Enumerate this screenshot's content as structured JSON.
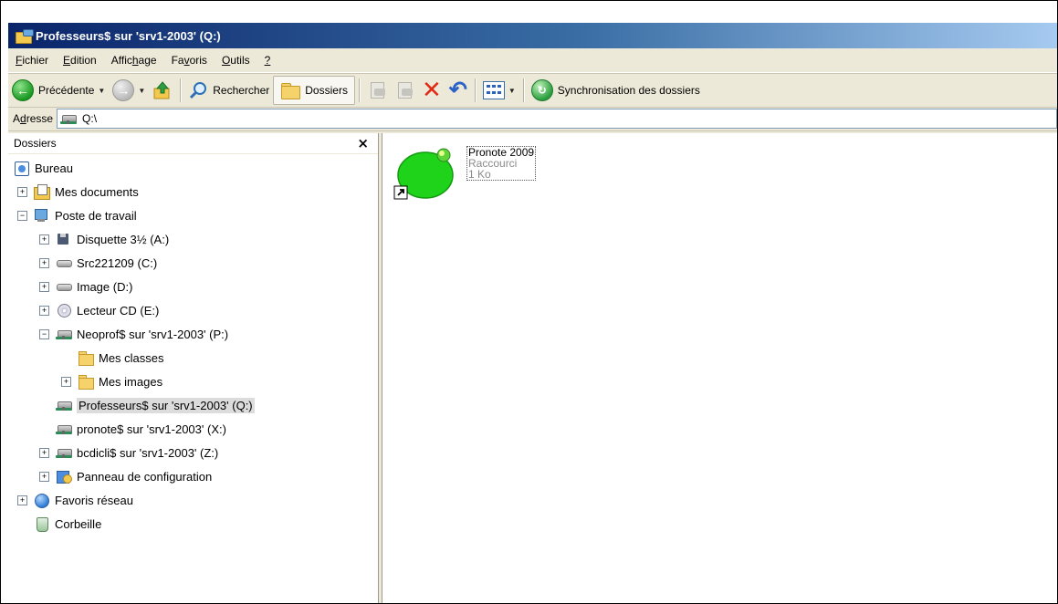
{
  "window": {
    "title": "Professeurs$ sur 'srv1-2003' (Q:)"
  },
  "menu": [
    {
      "pre": "",
      "acc": "F",
      "post": "ichier"
    },
    {
      "pre": "",
      "acc": "E",
      "post": "dition"
    },
    {
      "pre": "Affic",
      "acc": "h",
      "post": "age"
    },
    {
      "pre": "Fa",
      "acc": "v",
      "post": "oris"
    },
    {
      "pre": "",
      "acc": "O",
      "post": "utils"
    },
    {
      "pre": "",
      "acc": "?",
      "post": ""
    }
  ],
  "toolbar": {
    "back_label": "Précédente",
    "search_label": "Rechercher",
    "folders_label": "Dossiers",
    "sync_label": "Synchronisation des dossiers"
  },
  "address": {
    "label_pre": "A",
    "label_acc": "d",
    "label_post": "resse",
    "value": "Q:\\"
  },
  "folders_panel": {
    "title": "Dossiers",
    "close_glyph": "×"
  },
  "tree": [
    {
      "label": "Bureau",
      "level": 0,
      "exp": "none",
      "icon": "desktop-icon"
    },
    {
      "label": "Mes documents",
      "level": 1,
      "exp": "+",
      "icon": "my-documents-icon"
    },
    {
      "label": "Poste de travail",
      "level": 1,
      "exp": "-",
      "icon": "computer-icon"
    },
    {
      "label": "Disquette 3½ (A:)",
      "level": 2,
      "exp": "+",
      "icon": "floppy-drive-icon"
    },
    {
      "label": "Src221209 (C:)",
      "level": 2,
      "exp": "+",
      "icon": "hard-drive-icon"
    },
    {
      "label": "Image (D:)",
      "level": 2,
      "exp": "+",
      "icon": "hard-drive-icon"
    },
    {
      "label": "Lecteur CD (E:)",
      "level": 2,
      "exp": "+",
      "icon": "cd-drive-icon"
    },
    {
      "label": "Neoprof$ sur 'srv1-2003' (P:)",
      "level": 2,
      "exp": "-",
      "icon": "network-drive-icon"
    },
    {
      "label": "Mes classes",
      "level": 3,
      "exp": "none",
      "icon": "folder-icon"
    },
    {
      "label": "Mes images",
      "level": 3,
      "exp": "+",
      "icon": "folder-icon"
    },
    {
      "label": "Professeurs$ sur 'srv1-2003' (Q:)",
      "level": 2,
      "exp": "none",
      "icon": "network-drive-icon",
      "selected": true
    },
    {
      "label": "pronote$ sur 'srv1-2003' (X:)",
      "level": 2,
      "exp": "none",
      "icon": "network-drive-icon"
    },
    {
      "label": "bcdicli$ sur 'srv1-2003' (Z:)",
      "level": 2,
      "exp": "+",
      "icon": "network-drive-icon"
    },
    {
      "label": "Panneau de configuration",
      "level": 2,
      "exp": "+",
      "icon": "control-panel-icon"
    },
    {
      "label": "Favoris réseau",
      "level": 1,
      "exp": "+",
      "icon": "network-places-icon"
    },
    {
      "label": "Corbeille",
      "level": 1,
      "exp": "none",
      "icon": "recycle-bin-icon"
    }
  ],
  "files": [
    {
      "name": "Pronote 2009",
      "type": "Raccourci",
      "size": "1 Ko",
      "icon": "pronote-shortcut-icon"
    }
  ],
  "colors": {
    "title_bar_start": "#0a246a",
    "selection_bg": "#dcdcdc",
    "delete_red": "#e02a14",
    "pronote_green": "#1fd21a"
  }
}
